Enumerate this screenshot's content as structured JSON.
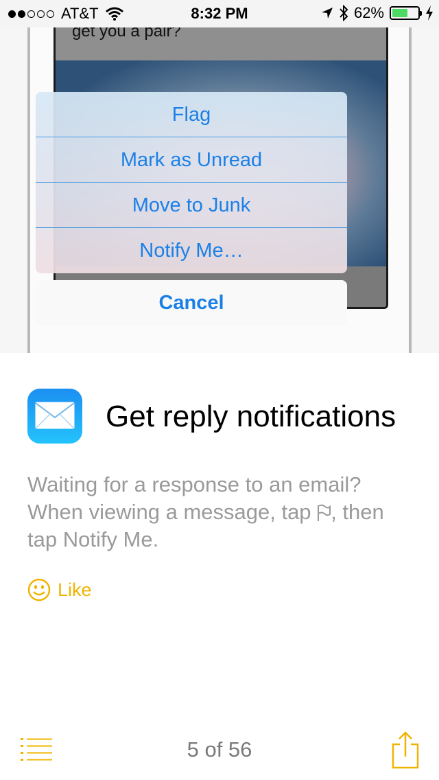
{
  "status_bar": {
    "carrier": "AT&T",
    "time": "8:32 PM",
    "battery": "62%",
    "battery_level": 0.62,
    "signal_bars_filled": 2,
    "signal_bars_total": 5,
    "icons": [
      "wifi-icon",
      "location-arrow-icon",
      "bluetooth-icon",
      "battery-icon",
      "charging-bolt-icon"
    ]
  },
  "illustration": {
    "message_text": "I found these new sunglasses, should I get you a pair?",
    "action_sheet": {
      "items": [
        "Flag",
        "Mark as Unread",
        "Move to Junk",
        "Notify Me…"
      ],
      "cancel": "Cancel"
    }
  },
  "tip": {
    "app_icon": "mail-icon",
    "title": "Get reply notifications",
    "description_part1": "Waiting for a response to an email? When viewing a message, tap",
    "description_part2": ", then tap Notify Me.",
    "inline_icon": "flag-icon",
    "like_label": "Like"
  },
  "bottom_bar": {
    "page_counter": "5 of 56",
    "list_icon": "list-icon",
    "share_icon": "share-icon"
  },
  "colors": {
    "accent": "#f0b400",
    "ios_blue": "#1b80e6",
    "battery_green": "#4cd964",
    "secondary_text": "#9a9a9a"
  }
}
